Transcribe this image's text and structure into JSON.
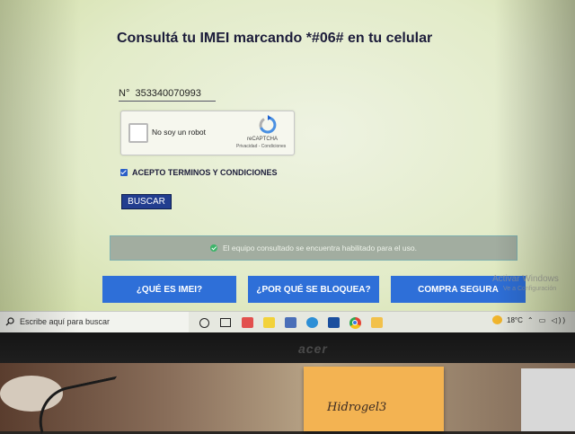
{
  "page": {
    "heading": "Consultá tu IMEI marcando *#06# en tu celular",
    "imei_value": "N°  353340070993",
    "recaptcha": {
      "label": "No soy un robot",
      "brand": "reCAPTCHA",
      "links": "Privacidad - Condiciones"
    },
    "terms_label": "ACEPTO TERMINOS Y CONDICIONES",
    "search_button": "BUSCAR",
    "status_message": "El equipo consultado se encuentra habilitado para el uso.",
    "nav_buttons": [
      "¿QUÉ ES IMEI?",
      "¿POR QUÉ SE BLOQUEA?",
      "COMPRA SEGURA"
    ],
    "activate_windows": "Activar Windows",
    "activate_windows_sub": "Ve a Configuración"
  },
  "taskbar": {
    "search_placeholder": "Escribe aquí para buscar",
    "temperature": "18°C",
    "apps": [
      "task-view-icon",
      "media-player-icon",
      "sticky-notes-icon",
      "calculator-icon",
      "cloud-app-icon",
      "clock-app-icon",
      "chrome-icon",
      "file-explorer-icon"
    ]
  },
  "monitor": {
    "brand": "acer"
  },
  "desk": {
    "sticky_note_text": "Hidrogel3"
  },
  "colors": {
    "heading": "#1c1c3a",
    "button_dark": "#223d8f",
    "nav_button": "#2e6fd8",
    "status_bg": "#a2ada0",
    "status_ok": "#3db46a"
  }
}
